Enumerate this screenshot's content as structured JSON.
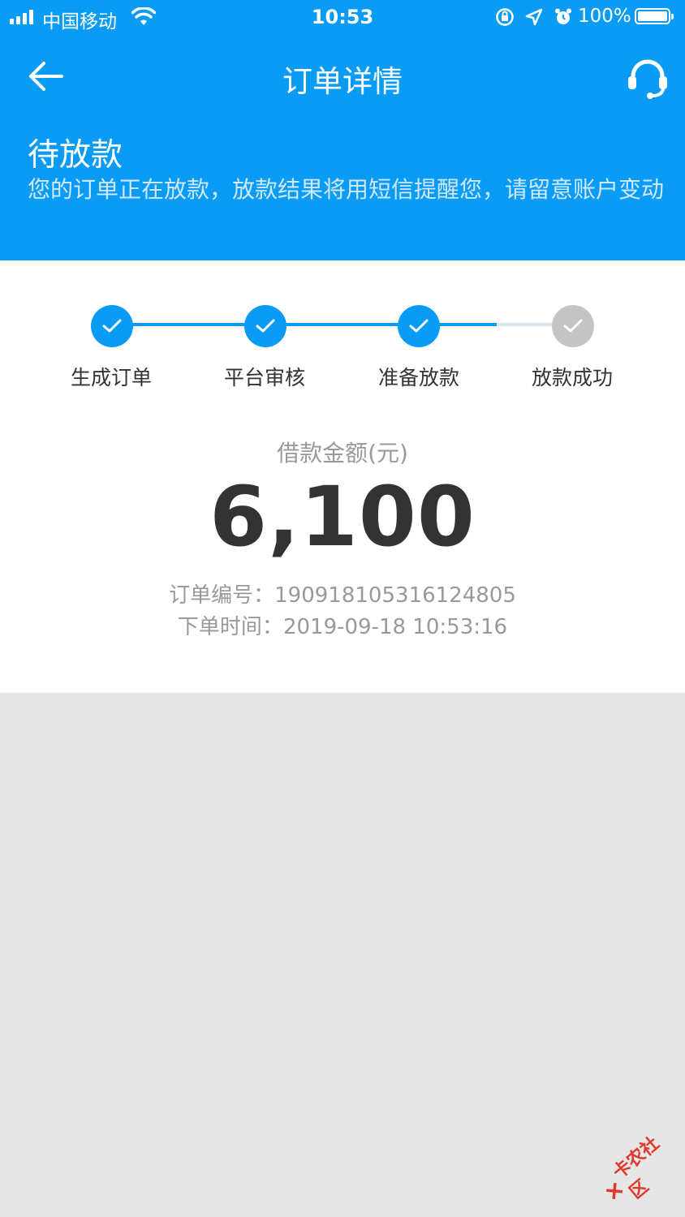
{
  "status_bar": {
    "carrier": "中国移动",
    "time": "10:53",
    "battery": "100%"
  },
  "nav": {
    "title": "订单详情"
  },
  "order_status": {
    "title": "待放款",
    "description": "您的订单正在放款，放款结果将用短信提醒您，请留意账户变动"
  },
  "steps": [
    {
      "label": "生成订单",
      "state": "done"
    },
    {
      "label": "平台审核",
      "state": "done"
    },
    {
      "label": "准备放款",
      "state": "done"
    },
    {
      "label": "放款成功",
      "state": "pending"
    }
  ],
  "loan": {
    "amount_label": "借款金额(元)",
    "amount": "6,100"
  },
  "order_info": {
    "number_label": "订单编号：",
    "number": "190918105316124805",
    "time_label": "下单时间：",
    "time": "2019-09-18 10:53:16"
  },
  "watermark": {
    "text": "卡农社区"
  },
  "colors": {
    "primary": "#0a9cf5",
    "pending": "#c4c4c4",
    "background": "#e6e6e6"
  },
  "icons": {
    "back": "arrow-left-icon",
    "service": "headset-icon",
    "step_done": "check-icon"
  }
}
